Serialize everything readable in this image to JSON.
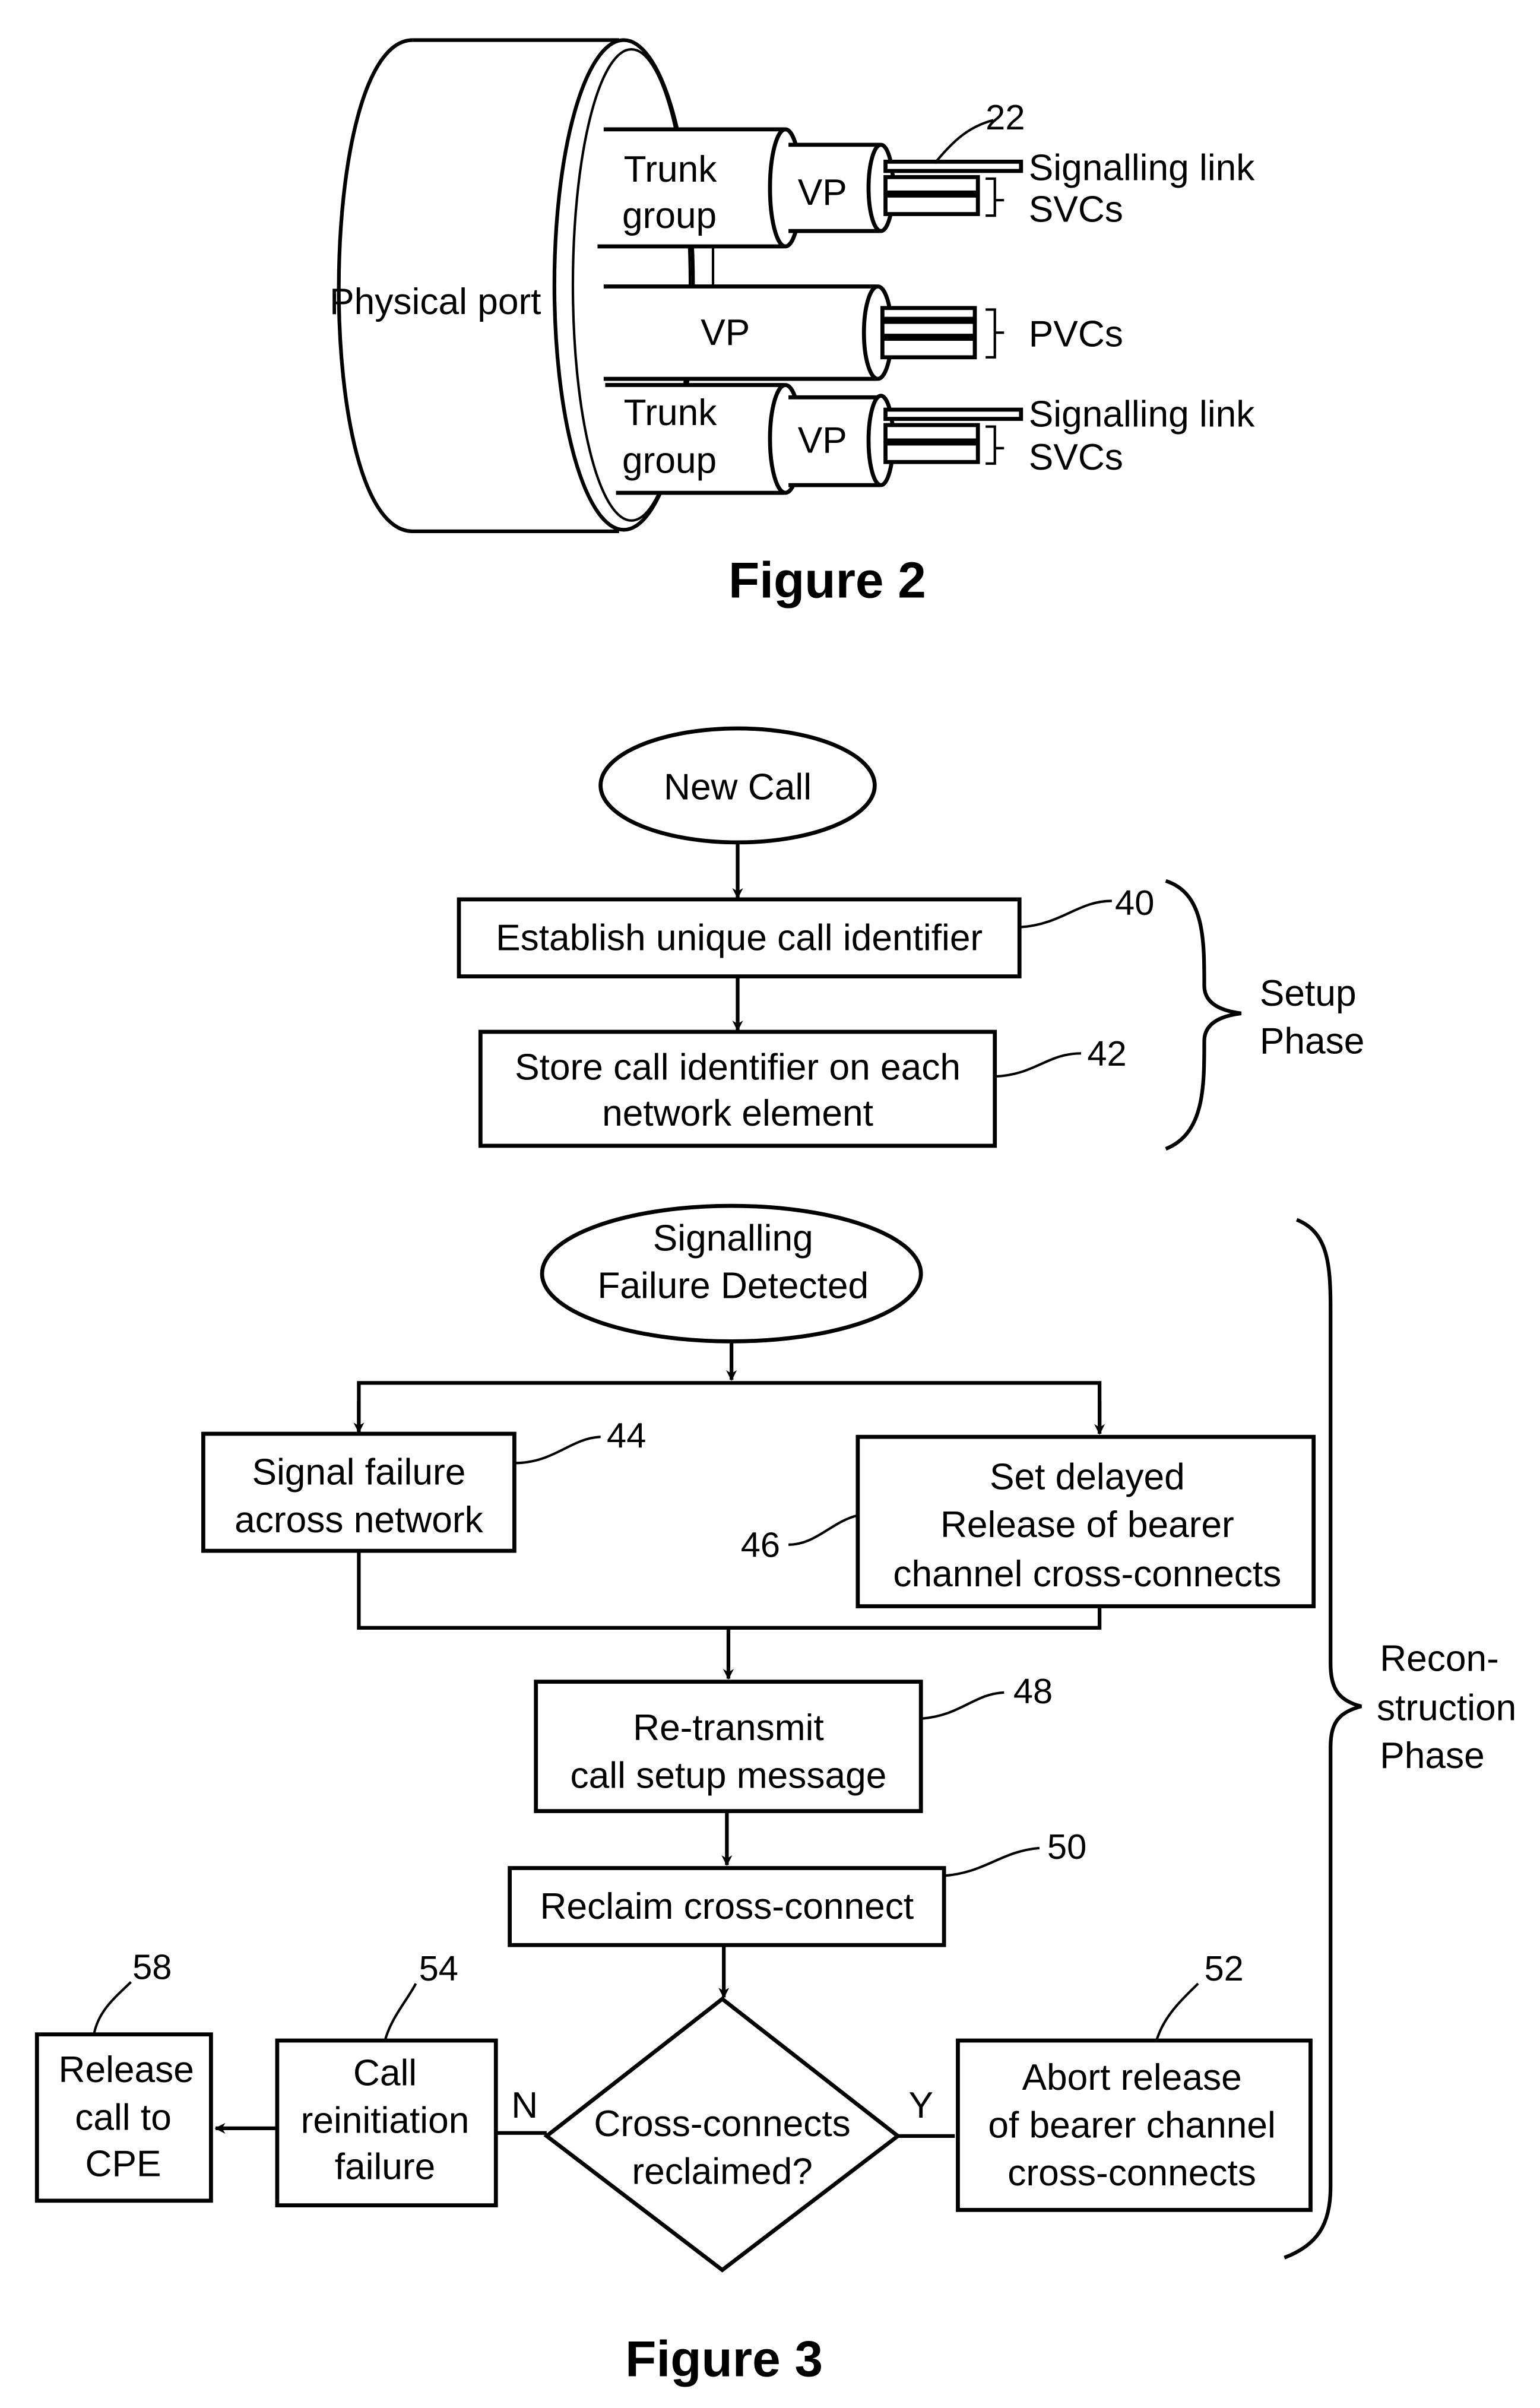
{
  "figure2": {
    "caption": "Figure 2",
    "physical_port_label": "Physical port",
    "reference_numeral": "22",
    "upper_trunk": {
      "line1": "Trunk",
      "line2": "group",
      "vp_label": "VP",
      "signalling_label": "Signalling link",
      "circuits_label": "SVCs"
    },
    "middle_vp": {
      "vp_label": "VP",
      "circuits_label": "PVCs"
    },
    "lower_trunk": {
      "line1": "Trunk",
      "line2": "group",
      "vp_label": "VP",
      "signalling_label": "Signalling link",
      "circuits_label": "SVCs"
    }
  },
  "figure3": {
    "caption": "Figure 3",
    "start_terminal": "New Call",
    "setup_phase": {
      "label_line1": "Setup",
      "label_line2": "Phase",
      "steps": [
        {
          "ref": "40",
          "lines": [
            "Establish unique call identifier"
          ]
        },
        {
          "ref": "42",
          "lines": [
            "Store call identifier on each",
            "network element"
          ]
        }
      ]
    },
    "reconstruction_phase": {
      "label_lines": [
        "Recon-",
        "struction",
        "Phase"
      ],
      "trigger_terminal": [
        "Signalling",
        "Failure Detected"
      ],
      "step_44": {
        "ref": "44",
        "lines": [
          "Signal failure",
          "across network"
        ]
      },
      "step_46": {
        "ref": "46",
        "lines": [
          "Set delayed",
          "Release of bearer",
          "channel cross-connects"
        ]
      },
      "step_48": {
        "ref": "48",
        "lines": [
          "Re-transmit",
          "call setup message"
        ]
      },
      "step_50": {
        "ref": "50",
        "lines": [
          "Reclaim cross-connect"
        ]
      },
      "decision": {
        "lines": [
          "Cross-connects",
          "reclaimed?"
        ],
        "no_label": "N",
        "yes_label": "Y"
      },
      "step_52": {
        "ref": "52",
        "lines": [
          "Abort release",
          "of bearer channel",
          "cross-connects"
        ]
      },
      "step_54": {
        "ref": "54",
        "lines": [
          "Call",
          "reinitiation",
          "failure"
        ]
      },
      "step_58": {
        "ref": "58",
        "lines": [
          "Release",
          "call to",
          "CPE"
        ]
      }
    }
  }
}
